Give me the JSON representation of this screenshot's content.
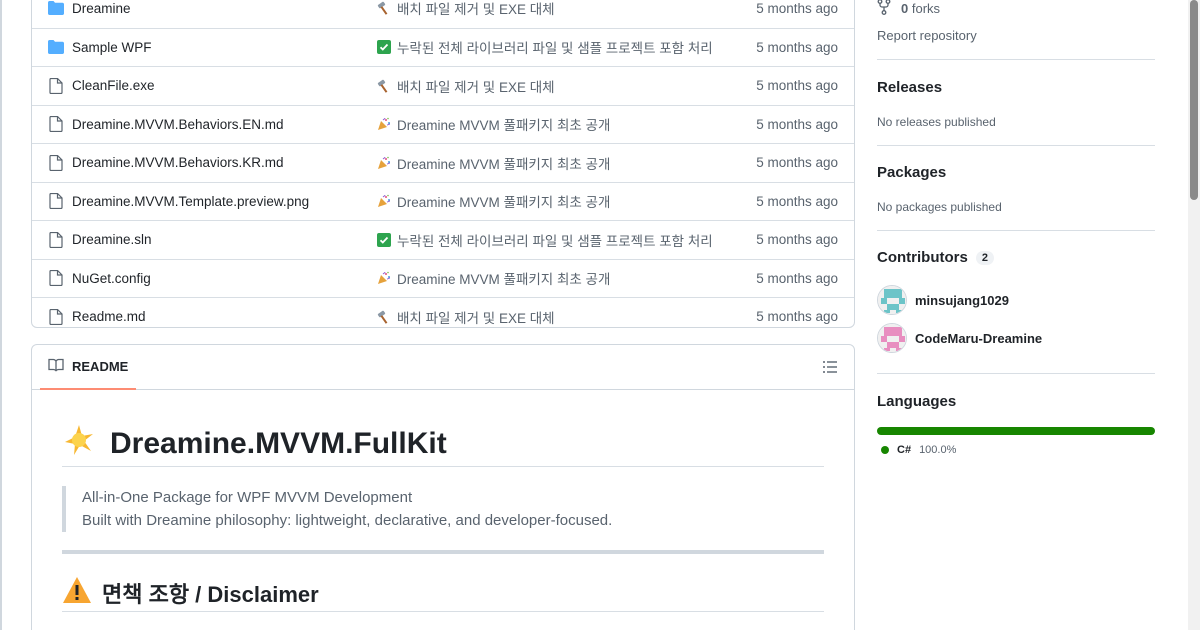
{
  "files": [
    {
      "name": "Dreamine",
      "type": "folder",
      "emoji": "hammer",
      "message": "배치 파일 제거 및 EXE 대체",
      "date": "5 months ago"
    },
    {
      "name": "Sample WPF",
      "type": "folder",
      "emoji": "check",
      "message": "누락된 전체 라이브러리 파일 및 샘플 프로젝트 포함 처리",
      "date": "5 months ago"
    },
    {
      "name": "CleanFile.exe",
      "type": "file",
      "emoji": "hammer",
      "message": "배치 파일 제거 및 EXE 대체",
      "date": "5 months ago"
    },
    {
      "name": "Dreamine.MVVM.Behaviors.EN.md",
      "type": "file",
      "emoji": "party",
      "message": "Dreamine MVVM 풀패키지 최초 공개",
      "date": "5 months ago"
    },
    {
      "name": "Dreamine.MVVM.Behaviors.KR.md",
      "type": "file",
      "emoji": "party",
      "message": "Dreamine MVVM 풀패키지 최초 공개",
      "date": "5 months ago"
    },
    {
      "name": "Dreamine.MVVM.Template.preview.png",
      "type": "file",
      "emoji": "party",
      "message": "Dreamine MVVM 풀패키지 최초 공개",
      "date": "5 months ago"
    },
    {
      "name": "Dreamine.sln",
      "type": "file",
      "emoji": "check",
      "message": "누락된 전체 라이브러리 파일 및 샘플 프로젝트 포함 처리",
      "date": "5 months ago"
    },
    {
      "name": "NuGet.config",
      "type": "file",
      "emoji": "party",
      "message": "Dreamine MVVM 풀패키지 최초 공개",
      "date": "5 months ago"
    },
    {
      "name": "Readme.md",
      "type": "file",
      "emoji": "hammer",
      "message": "배치 파일 제거 및 EXE 대체",
      "date": "5 months ago"
    }
  ],
  "readme": {
    "tab_label": "README",
    "title": "Dreamine.MVVM.FullKit",
    "quote_line1": "All-in-One Package for WPF MVVM Development",
    "quote_line2": "Built with Dreamine philosophy: lightweight, declarative, and developer-focused.",
    "disclaimer": "면책 조항 / Disclaimer"
  },
  "sidebar": {
    "forks_count": "0",
    "forks_label": "forks",
    "report_label": "Report repository",
    "releases_title": "Releases",
    "releases_sub": "No releases published",
    "packages_title": "Packages",
    "packages_sub": "No packages published",
    "contributors_title": "Contributors",
    "contributors_count": "2",
    "contributors": [
      {
        "name": "minsujang1029",
        "color": "#6cc4c8"
      },
      {
        "name": "CodeMaru-Dreamine",
        "color": "#e88ec0"
      }
    ],
    "languages_title": "Languages",
    "language_name": "C#",
    "language_pct": "100.0%",
    "language_share": 100,
    "language_color": "#178600"
  }
}
